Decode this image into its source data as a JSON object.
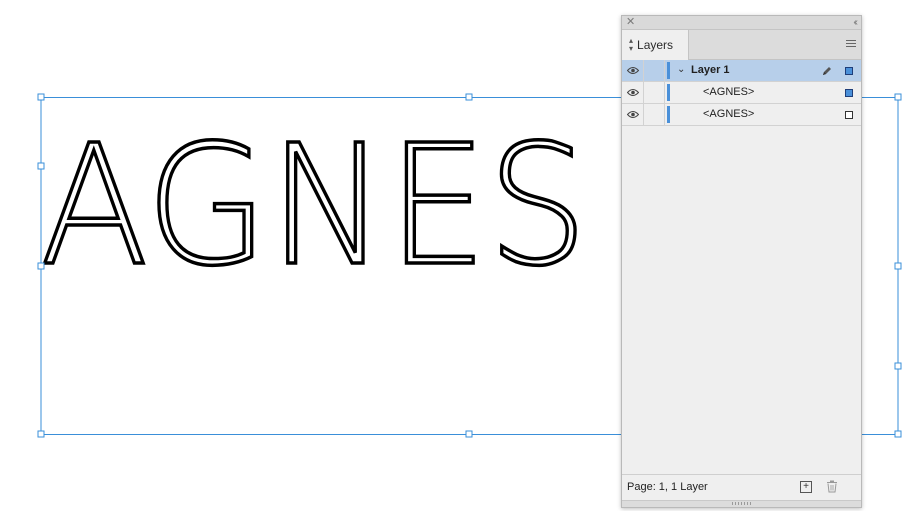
{
  "canvas": {
    "artwork_text": "AGNES",
    "selection_color": "#3a8fd9"
  },
  "layers_panel": {
    "tab_label": "Layers",
    "layers": [
      {
        "name": "Layer 1",
        "color": "#4a90d9",
        "expanded": true,
        "objects": [
          {
            "name": "<AGNES>",
            "selected": true
          },
          {
            "name": "<AGNES>",
            "selected": false
          }
        ]
      }
    ],
    "status": "Page: 1, 1 Layer"
  },
  "icons": [
    "close-icon",
    "collapse-icon",
    "updown-icon",
    "panel-menu-icon",
    "eye-icon",
    "chevron-down-icon",
    "pen-icon",
    "new-layer-icon",
    "trash-icon"
  ]
}
